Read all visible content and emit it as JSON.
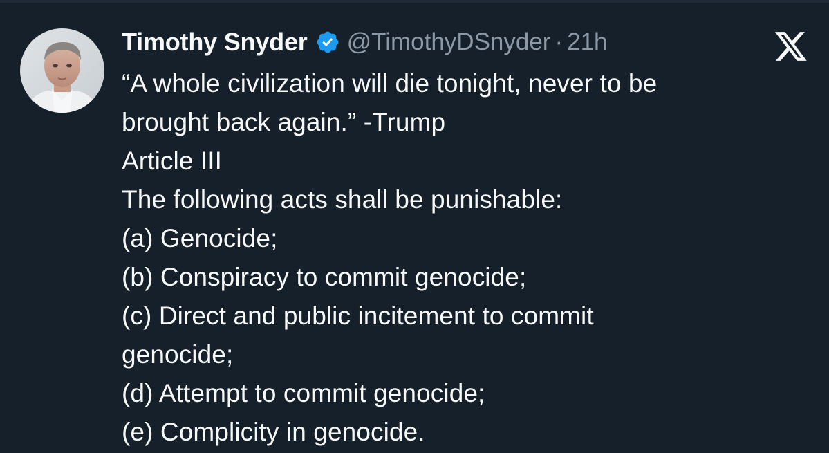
{
  "tweet": {
    "author_name": "Timothy Snyder",
    "handle": "@TimothyDSnyder",
    "separator": "·",
    "timestamp": "21h",
    "lines": [
      "“A whole civilization will die tonight, never to be",
      "brought back again.” -Trump",
      "Article III",
      "The following acts shall be punishable:",
      "(a) Genocide;",
      "(b) Conspiracy to commit genocide;",
      "(c) Direct and public incitement to commit",
      "genocide;",
      "(d) Attempt to commit genocide;",
      "(e) Complicity in genocide."
    ]
  },
  "icons": {
    "verified": "verified-badge-icon",
    "brand": "x-logo-icon"
  },
  "colors": {
    "background": "#15202b",
    "text_primary": "#f7f9f9",
    "text_secondary": "#8b98a5",
    "verified_blue": "#1d9bf0"
  }
}
